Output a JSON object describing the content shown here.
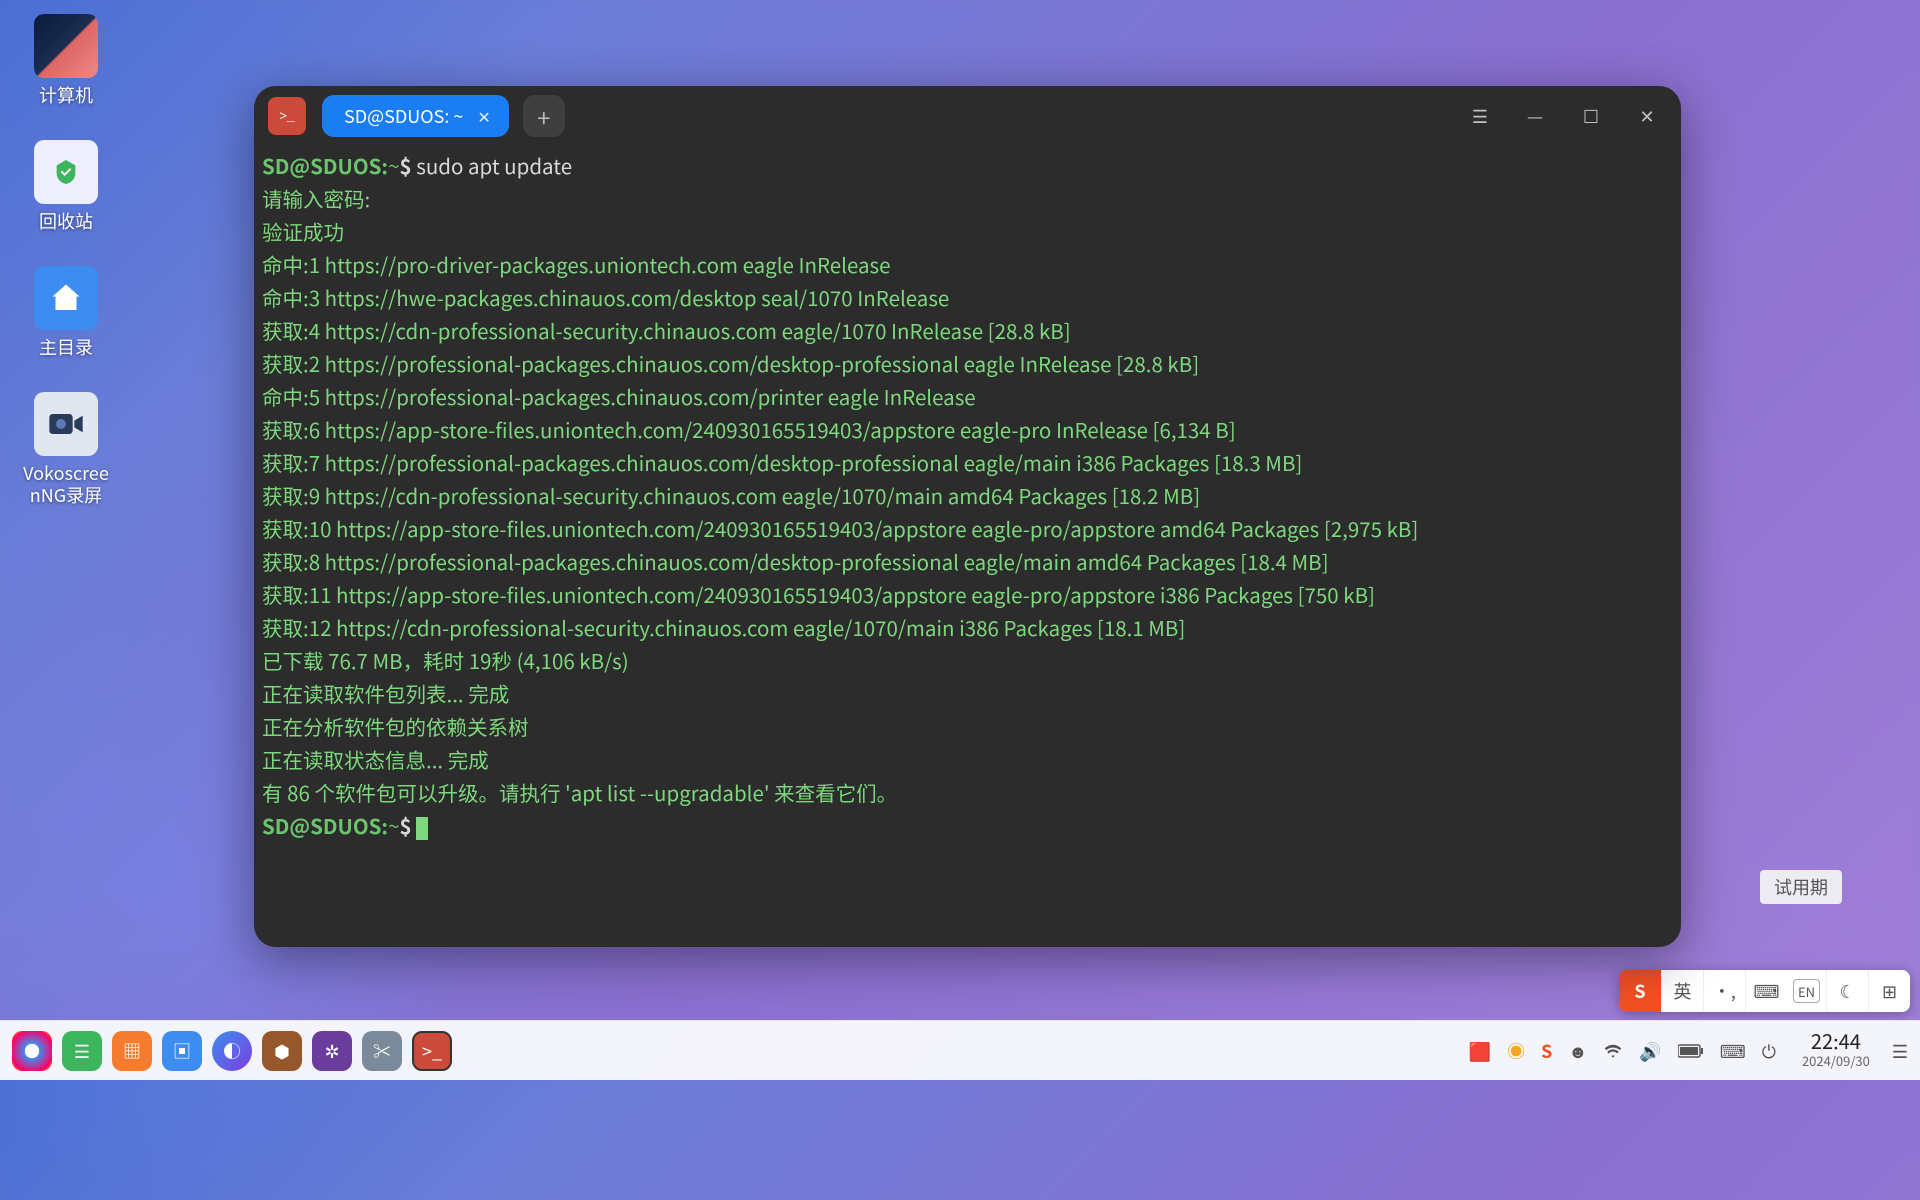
{
  "desktop": {
    "computer": "计算机",
    "trash": "回收站",
    "home": "主目录",
    "vokoscreen": "Vokoscree\nnNG录屏"
  },
  "terminal": {
    "tab_title": "SD@SDUOS: ~",
    "prompt_user": "SD@SDUOS",
    "prompt_colon": ":",
    "prompt_path": "~",
    "prompt_dollar": "$ ",
    "cmd1": "sudo apt update",
    "lines": {
      "l1": "请输入密码:",
      "l2": "验证成功",
      "l3": "命中:1 https://pro-driver-packages.uniontech.com eagle InRelease",
      "l4": "命中:3 https://hwe-packages.chinauos.com/desktop seal/1070 InRelease",
      "l5": "获取:4 https://cdn-professional-security.chinauos.com eagle/1070 InRelease [28.8 kB]",
      "l6": "获取:2 https://professional-packages.chinauos.com/desktop-professional eagle InRelease [28.8 kB]",
      "l7": "命中:5 https://professional-packages.chinauos.com/printer eagle InRelease",
      "l8": "获取:6 https://app-store-files.uniontech.com/240930165519403/appstore eagle-pro InRelease [6,134 B]",
      "l9": "获取:7 https://professional-packages.chinauos.com/desktop-professional eagle/main i386 Packages [18.3 MB]",
      "l10": "获取:9 https://cdn-professional-security.chinauos.com eagle/1070/main amd64 Packages [18.2 MB]",
      "l11": "获取:10 https://app-store-files.uniontech.com/240930165519403/appstore eagle-pro/appstore amd64 Packages [2,975 kB]",
      "l12": "获取:8 https://professional-packages.chinauos.com/desktop-professional eagle/main amd64 Packages [18.4 MB]",
      "l13": "获取:11 https://app-store-files.uniontech.com/240930165519403/appstore eagle-pro/appstore i386 Packages [750 kB]",
      "l14": "获取:12 https://cdn-professional-security.chinauos.com eagle/1070/main i386 Packages [18.1 MB]",
      "l15": "已下载 76.7 MB，耗时 19秒 (4,106 kB/s)",
      "l16": "正在读取软件包列表... 完成",
      "l17": "正在分析软件包的依赖关系树",
      "l18": "正在读取状态信息... 完成",
      "l19": "有 86 个软件包可以升级。请执行 'apt list --upgradable' 来查看它们。"
    }
  },
  "trial": "试用期",
  "ime": {
    "logo": "S",
    "lang": "英",
    "punct": "•,",
    "kbd": "⌨",
    "en": "EN",
    "moon": "☾",
    "grid": "⊞"
  },
  "tray": {
    "time": "22:44",
    "date": "2024/09/30"
  }
}
